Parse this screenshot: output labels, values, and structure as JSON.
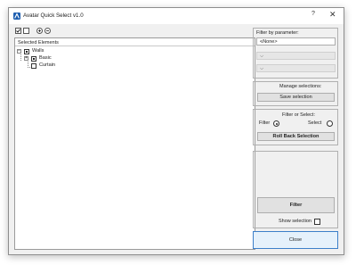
{
  "window": {
    "title": "Avatar Quick Select v1.0",
    "help": "?",
    "close": "✕"
  },
  "tree": {
    "header": "Selected Elements",
    "items": [
      {
        "label": "Walls"
      },
      {
        "label": "Basic"
      },
      {
        "label": "Curtain"
      }
    ]
  },
  "filter_param": {
    "title": "Filter by parameter:",
    "select_value": "<None>"
  },
  "manage": {
    "title": "Manage selections:",
    "save_label": "Save selection"
  },
  "filter_select": {
    "title": "Filter or Select:",
    "filter_label": "Filter",
    "select_label": "Select",
    "rollback_label": "Roll Back Selection"
  },
  "actions": {
    "filter_label": "Filter",
    "show_selection_label": "Show selection",
    "close_label": "Close"
  }
}
